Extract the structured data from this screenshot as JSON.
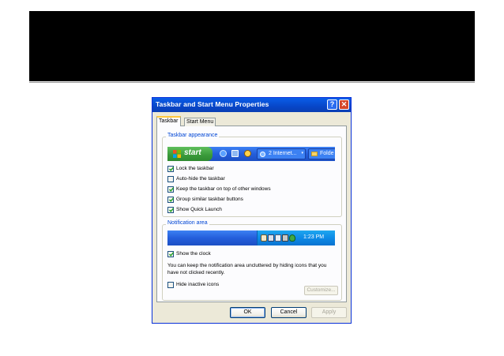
{
  "window": {
    "title": "Taskbar and Start Menu Properties",
    "help_label": "?",
    "close_label": "✕"
  },
  "tabs": [
    {
      "label": "Taskbar",
      "selected": true
    },
    {
      "label": "Start Menu",
      "selected": false
    }
  ],
  "taskbar_appearance": {
    "title": "Taskbar appearance",
    "preview": {
      "start_label": "start",
      "task_buttons": [
        "2 Internet...",
        "Folde"
      ],
      "quick_launch_icons": [
        "internet-explorer-icon",
        "show-desktop-icon",
        "media-player-icon"
      ]
    },
    "options": [
      {
        "label": "Lock the taskbar",
        "checked": true
      },
      {
        "label": "Auto-hide the taskbar",
        "checked": false
      },
      {
        "label": "Keep the taskbar on top of other windows",
        "checked": true
      },
      {
        "label": "Group similar taskbar buttons",
        "checked": true
      },
      {
        "label": "Show Quick Launch",
        "checked": true
      }
    ]
  },
  "notification_area": {
    "title": "Notification area",
    "preview": {
      "clock": "1:23 PM",
      "tray_icons": [
        "hand-icon",
        "network-icon",
        "mail-icon",
        "speaker-icon",
        "shield-icon"
      ]
    },
    "show_clock": {
      "label": "Show the clock",
      "checked": true
    },
    "description": "You can keep the notification area uncluttered by hiding icons that you have not clicked recently.",
    "hide_inactive": {
      "label": "Hide inactive icons",
      "checked": false
    },
    "customize_label": "Customize..."
  },
  "buttons": {
    "ok": "OK",
    "cancel": "Cancel",
    "apply": "Apply"
  },
  "colors": {
    "titlebar": "#0a5ee8",
    "dialog_bg": "#ece9d8",
    "group_title": "#0046d5",
    "start_green": "#3a9a3a"
  }
}
